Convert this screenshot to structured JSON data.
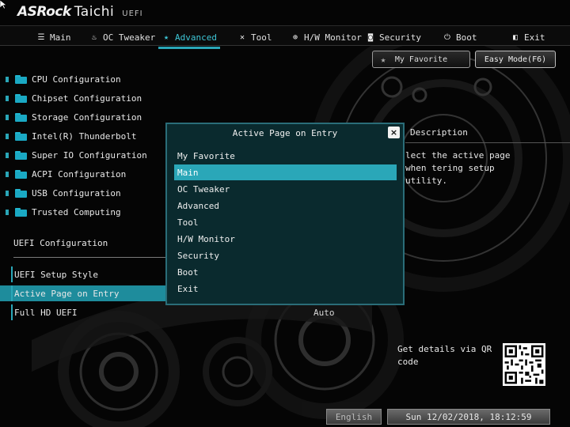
{
  "brand": {
    "name": "ASRock",
    "model": "Taichi",
    "suffix": "UEFI"
  },
  "colors": {
    "accent": "#2aa7b8",
    "highlight": "#1e8c9c",
    "popup_bg": "#0a2a2e",
    "folder": "#1aa9c4"
  },
  "nav": {
    "tabs": [
      {
        "label": "Main",
        "icon": "list-icon",
        "active": false
      },
      {
        "label": "OC Tweaker",
        "icon": "flame-icon",
        "active": false
      },
      {
        "label": "Advanced",
        "icon": "star-icon",
        "active": true
      },
      {
        "label": "Tool",
        "icon": "tools-icon",
        "active": false
      },
      {
        "label": "H/W Monitor",
        "icon": "monitor-icon",
        "active": false
      },
      {
        "label": "Security",
        "icon": "shield-icon",
        "active": false
      },
      {
        "label": "Boot",
        "icon": "power-icon",
        "active": false
      },
      {
        "label": "Exit",
        "icon": "exit-icon",
        "active": false
      }
    ]
  },
  "top_buttons": {
    "favorite": "My Favorite",
    "easy_mode": "Easy Mode(F6)"
  },
  "menu": {
    "items": [
      {
        "label": "CPU Configuration"
      },
      {
        "label": "Chipset Configuration"
      },
      {
        "label": "Storage Configuration"
      },
      {
        "label": "Intel(R) Thunderbolt"
      },
      {
        "label": "Super IO Configuration"
      },
      {
        "label": "ACPI Configuration"
      },
      {
        "label": "USB Configuration"
      },
      {
        "label": "Trusted Computing"
      }
    ],
    "section": "UEFI Configuration",
    "options": [
      {
        "label": "UEFI Setup Style",
        "value": ""
      },
      {
        "label": "Active Page on Entry",
        "value": ""
      },
      {
        "label": "Full HD UEFI",
        "value": "Auto"
      }
    ]
  },
  "description": {
    "title": "Description",
    "text": "lect the active page when tering setup utility.",
    "qr_text": "Get details via QR code"
  },
  "popup": {
    "title": "Active Page on Entry",
    "close": "×",
    "options": [
      "My Favorite",
      "Main",
      "OC Tweaker",
      "Advanced",
      "Tool",
      "H/W Monitor",
      "Security",
      "Boot",
      "Exit"
    ],
    "selected": "Main"
  },
  "status": {
    "language": "English",
    "datetime": "Sun 12/02/2018, 18:12:59"
  }
}
